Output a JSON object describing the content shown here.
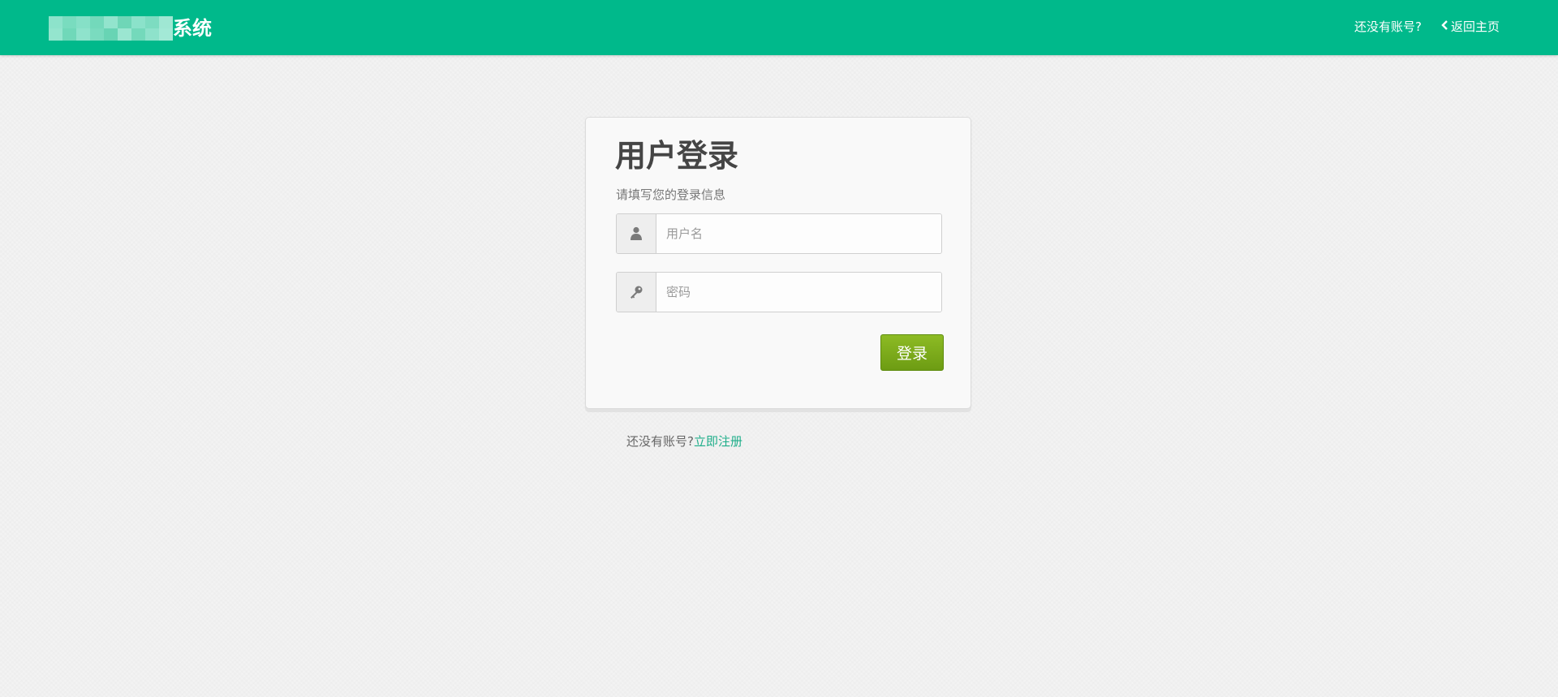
{
  "header": {
    "brand_suffix": "系统",
    "no_account": "还没有账号?",
    "back_home": "返回主页",
    "colors": {
      "bar": "#00b98b"
    }
  },
  "login": {
    "title": "用户登录",
    "subtitle": "请填写您的登录信息",
    "username_placeholder": "用户名",
    "username_icon": "user-icon",
    "password_placeholder": "密码",
    "password_icon": "key-icon",
    "submit_label": "登录",
    "colors": {
      "button": "#7aa91a"
    }
  },
  "footer": {
    "prompt": "还没有账号?",
    "register_link": "立即注册",
    "colors": {
      "link": "#1fae8a"
    }
  }
}
